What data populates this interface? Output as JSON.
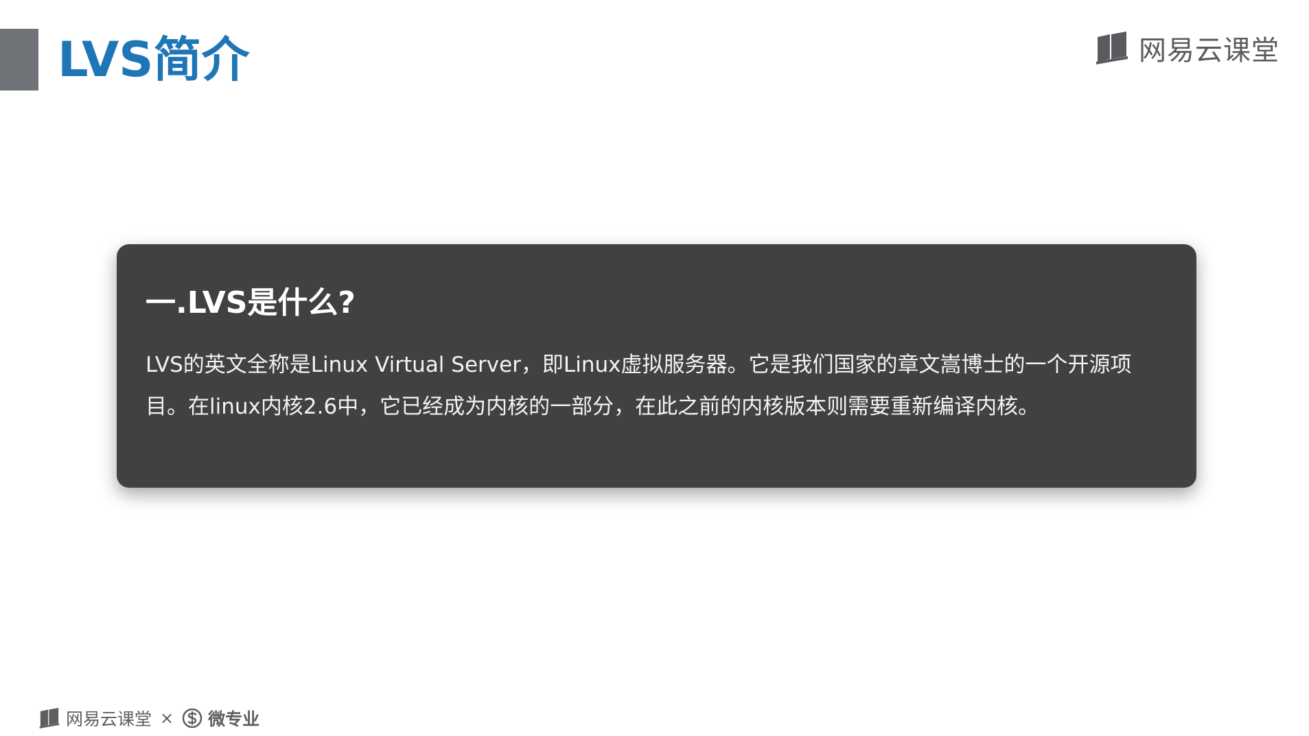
{
  "header": {
    "title": "LVS简介",
    "brand": "网易云课堂"
  },
  "card": {
    "heading": "一.LVS是什么?",
    "body": "LVS的英文全称是Linux Virtual Server，即Linux虚拟服务器。它是我们国家的章文嵩博士的一个开源项目。在linux内核2.6中，它已经成为内核的一部分，在此之前的内核版本则需要重新编译内核。"
  },
  "footer": {
    "brand": "网易云课堂",
    "separator": "×",
    "partner": "微专业"
  },
  "colors": {
    "title": "#1e76b7",
    "accent_bar": "#6f7377",
    "card_bg": "#414141",
    "brand_gray": "#595b5e"
  },
  "icons": {
    "brand_logo": "book-logo-icon",
    "partner_logo": "s-circle-logo-icon"
  }
}
